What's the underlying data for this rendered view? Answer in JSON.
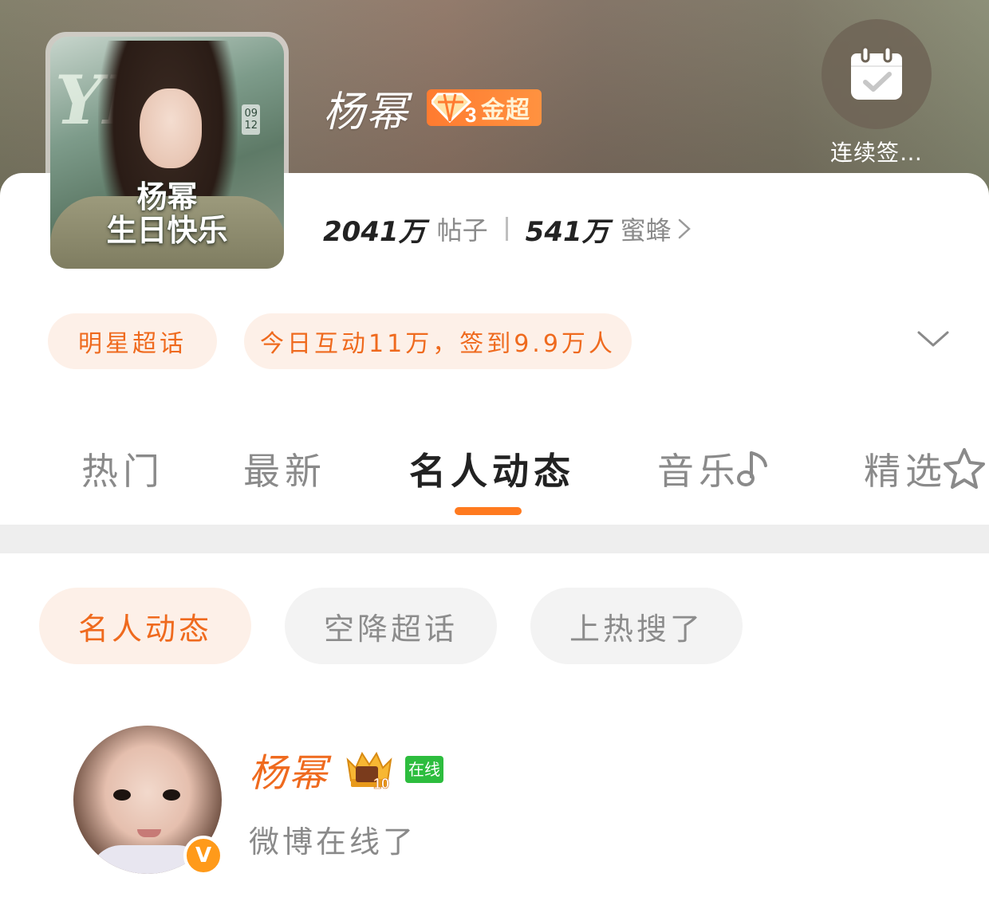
{
  "header": {
    "cover": {
      "letters": "YI",
      "date": "09\n12",
      "title": "杨幂\n生日快乐"
    },
    "title": "杨幂",
    "badge": {
      "icon": "diamond-level-icon",
      "level": "3",
      "label": "金超"
    },
    "checkin": {
      "icon": "calendar-check-icon",
      "label": "连续签…"
    }
  },
  "stats": {
    "posts_count": "2041万",
    "posts_label": "帖子",
    "fans_count": "541万",
    "fans_label": "蜜蜂"
  },
  "info_pills": {
    "category": "明星超话",
    "activity": "今日互动11万，签到9.9万人"
  },
  "tabs": [
    {
      "label": "热门"
    },
    {
      "label": "最新"
    },
    {
      "label": "名人动态"
    },
    {
      "label": "音乐",
      "icon": "music-note-icon"
    },
    {
      "label": "精选",
      "icon": "star-icon"
    }
  ],
  "active_tab": "名人动态",
  "filters": [
    {
      "label": "名人动态"
    },
    {
      "label": "空降超话"
    },
    {
      "label": "上热搜了"
    }
  ],
  "post": {
    "name": "杨幂",
    "crown_icon": "crown-level-icon",
    "crown_level": "10",
    "online_label": "在线",
    "verify_label": "V",
    "status": "微博在线了"
  },
  "colors": {
    "accent": "#ff7a1f",
    "accent_text": "#ef6a1e",
    "pill_bg": "#fdf0e8",
    "gray_pill_bg": "#f3f3f3",
    "online_green": "#2dbd3e"
  }
}
